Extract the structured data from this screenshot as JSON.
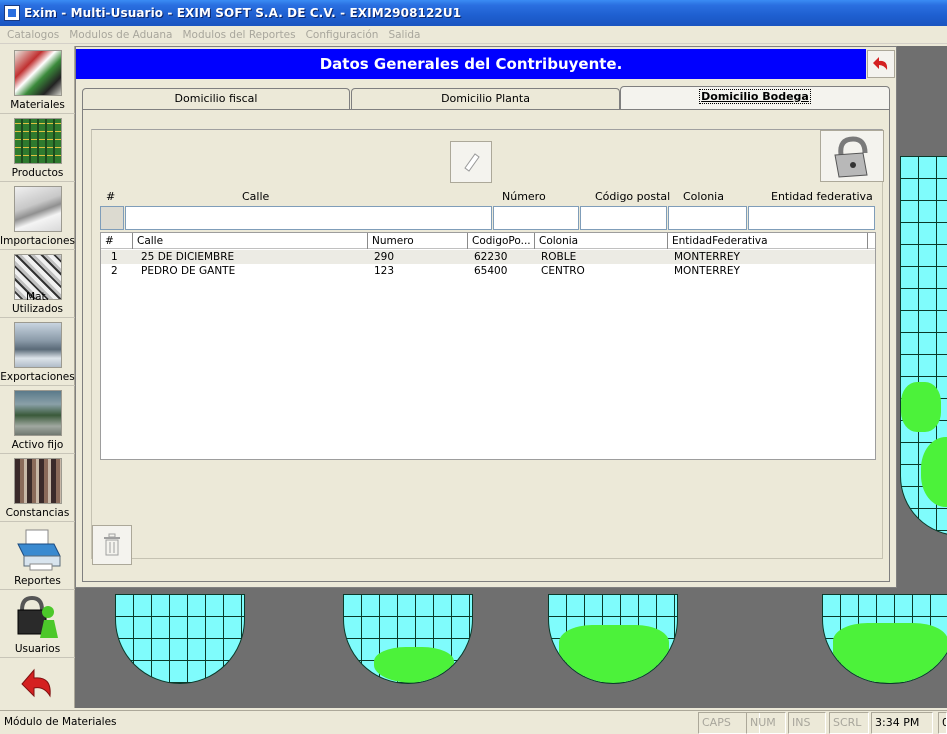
{
  "window": {
    "title": "Exim - Multi-Usuario - EXIM SOFT S.A. DE C.V. - EXIM2908122U1"
  },
  "menu": [
    "Catalogos",
    "Modulos de Aduana",
    "Modulos del Reportes",
    "Configuración",
    "Salida"
  ],
  "sidebar": {
    "items": [
      {
        "label": "Materiales",
        "icon": "materials-icon"
      },
      {
        "label": "Productos",
        "icon": "circuit-board-icon"
      },
      {
        "label": "Importaciones",
        "icon": "airplane-icon"
      },
      {
        "label": "Mat. Utilizados",
        "icon": "parts-icon"
      },
      {
        "label": "Exportaciones",
        "icon": "ship-icon"
      },
      {
        "label": "Activo fijo",
        "icon": "factory-icon"
      },
      {
        "label": "Constancias",
        "icon": "warehouse-icon"
      },
      {
        "label": "Reportes",
        "icon": "printer-icon"
      },
      {
        "label": "Usuarios",
        "icon": "user-lock-icon"
      },
      {
        "label": "",
        "icon": "back-arrow-icon"
      }
    ]
  },
  "dialog": {
    "title": "Datos Generales del Contribuyente.",
    "tabs": [
      "Domicilio fiscal",
      "Domicilio Planta",
      "Domicilio Bodega"
    ],
    "active_tab": "Domicilio Bodega",
    "form_headers": {
      "num": "#",
      "calle": "Calle",
      "numero": "Número",
      "cp": "Código postal",
      "colonia": "Colonia",
      "entidad": "Entidad federativa"
    },
    "inputs": {
      "calle": "",
      "numero": "",
      "cp": "",
      "colonia": "",
      "entidad": ""
    },
    "grid": {
      "columns": [
        "#",
        "Calle",
        "Numero",
        "CodigoPo...",
        "Colonia",
        "EntidadFederativa"
      ],
      "rows": [
        [
          "1",
          "25 DE DICIEMBRE",
          "290",
          "62230",
          "ROBLE",
          "MONTERREY"
        ],
        [
          "2",
          "PEDRO DE GANTE",
          "123",
          "65400",
          "CENTRO",
          "MONTERREY"
        ]
      ]
    }
  },
  "status": {
    "message": "Módulo de Materiales",
    "caps": "CAPS",
    "num": "NUM",
    "ins": "INS",
    "scrl": "SCRL",
    "time": "3:34 PM",
    "extra": "0"
  },
  "colors": {
    "title_bar": "#2a6fe0",
    "dialog_header": "#0000ff",
    "globe_water": "#7ffcfc",
    "globe_land": "#4cf23a"
  }
}
